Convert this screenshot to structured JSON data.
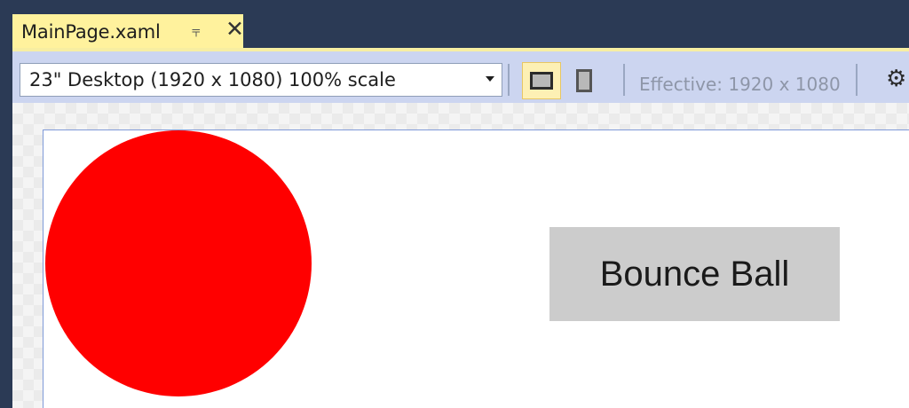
{
  "tab": {
    "title": "MainPage.xaml",
    "pin_icon": "pin-icon",
    "close_icon": "close-icon",
    "color": "#fff29d"
  },
  "toolbar": {
    "device_select": {
      "value": "23\" Desktop (1920 x 1080) 100% scale",
      "icon": "chevron-down-icon"
    },
    "orientation": {
      "landscape_selected": true,
      "landscape_icon": "landscape-icon",
      "portrait_icon": "portrait-icon"
    },
    "effective_resolution": "Effective: 1920 x 1080",
    "settings_icon": "gear-icon"
  },
  "canvas": {
    "ball_color": "#ff0000",
    "button_label": "Bounce Ball",
    "button_color": "#cccccc"
  }
}
